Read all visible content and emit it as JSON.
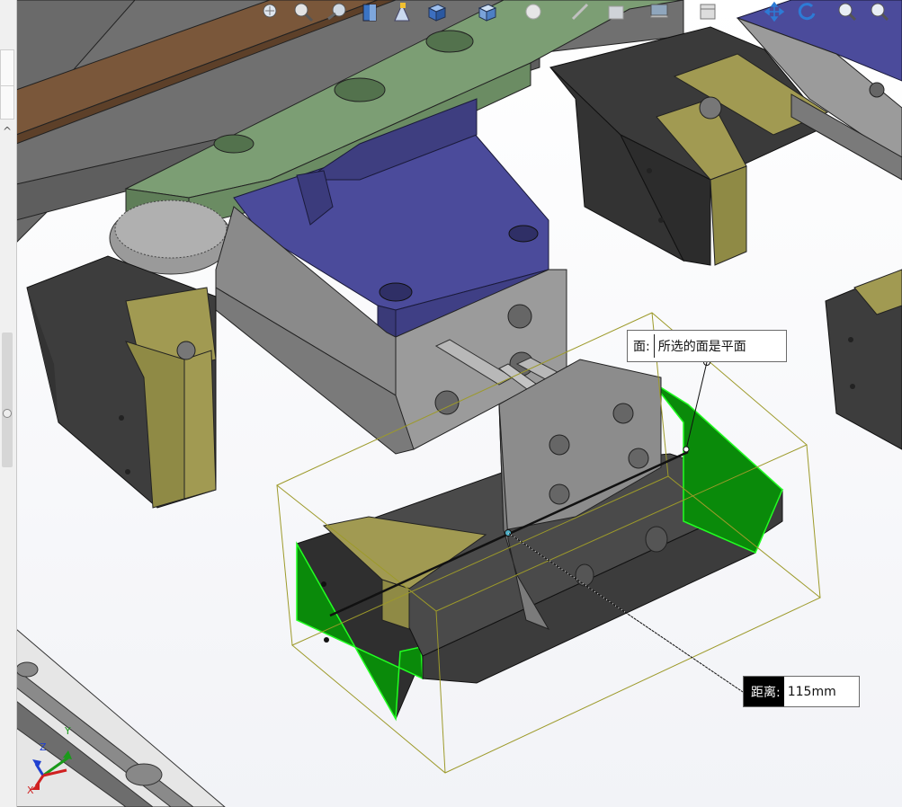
{
  "toolbar": {
    "buttons": [
      {
        "name": "zoom-to-fit-icon"
      },
      {
        "name": "zoom-to-area-icon"
      },
      {
        "name": "previous-view-icon"
      },
      {
        "name": "section-view-icon"
      },
      {
        "name": "dynamic-annotation-icon"
      },
      {
        "name": "view-orientation-icon"
      },
      {
        "name": "display-style-icon"
      },
      {
        "name": "hide-show-items-icon"
      },
      {
        "name": "edit-appearance-icon"
      },
      {
        "name": "apply-scene-icon"
      },
      {
        "name": "view-settings-icon"
      },
      {
        "name": "monitor-icon"
      },
      {
        "name": "window-icon"
      },
      {
        "name": "pan-icon"
      },
      {
        "name": "rotate-icon"
      },
      {
        "name": "zoom-in-out-icon"
      },
      {
        "name": "zoom-selection-icon"
      }
    ]
  },
  "callouts": {
    "face": {
      "label": "面:",
      "value": "所选的面是平面"
    },
    "distance": {
      "label": "距离:",
      "value": "115mm"
    }
  },
  "triad": {
    "x": "X",
    "y": "Y",
    "z": "Z"
  },
  "colors": {
    "dark_gray": "#3d3d3d",
    "blue_part": "#4b4b9b",
    "olive": "#a19a52",
    "green_plate": "#7c9e74",
    "brown_rail": "#7a573a",
    "selected_face": "#0a8a0a",
    "selection_line": "#111111",
    "bbox": "#9d9a2a"
  }
}
